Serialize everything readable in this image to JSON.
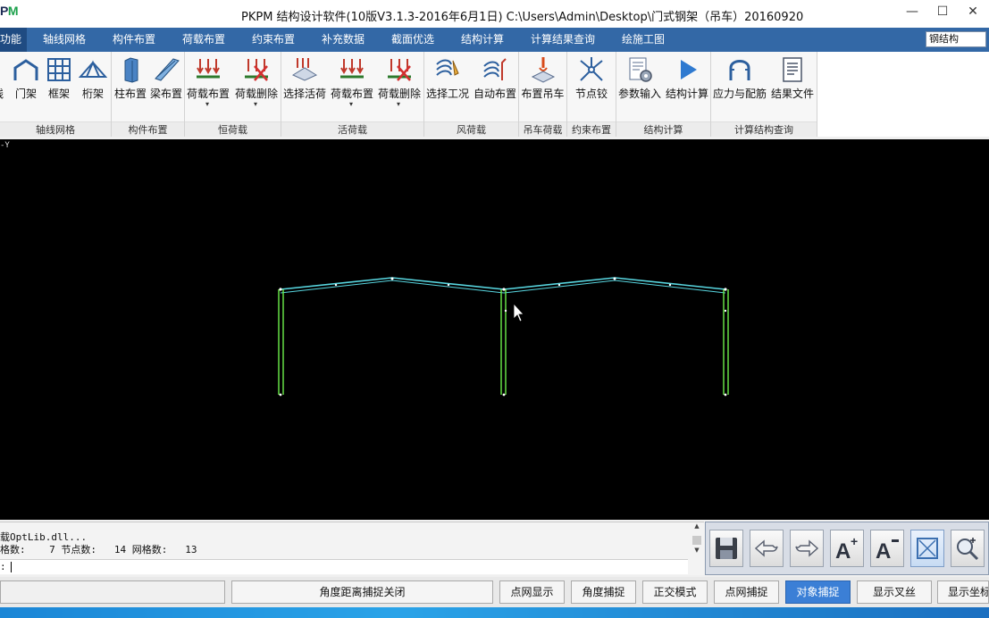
{
  "app": {
    "logo": "PM",
    "title": "PKPM 结构设计软件(10版V3.1.3-2016年6月1日) C:\\Users\\Admin\\Desktop\\门式钢架（吊车）20160920",
    "minimize": "—",
    "maximize": "☐",
    "close": "✕"
  },
  "menu": {
    "items": [
      "功能",
      "轴线网格",
      "构件布置",
      "荷载布置",
      "约束布置",
      "补充数据",
      "截面优选",
      "结构计算",
      "计算结果查询",
      "绘施工图"
    ],
    "active_index": 0,
    "right_select": "钢结构"
  },
  "ribbon": {
    "groups": [
      {
        "label": "轴线网格",
        "buttons": [
          "线",
          "门架",
          "框架",
          "桁架"
        ]
      },
      {
        "label": "构件布置",
        "buttons": [
          "柱布置",
          "梁布置"
        ]
      },
      {
        "label": "恒荷载",
        "buttons": [
          "荷载布置",
          "荷载删除"
        ]
      },
      {
        "label": "活荷载",
        "buttons": [
          "选择活荷",
          "荷载布置",
          "荷载删除"
        ]
      },
      {
        "label": "风荷载",
        "buttons": [
          "选择工况",
          "自动布置"
        ]
      },
      {
        "label": "吊车荷载",
        "buttons": [
          "布置吊车"
        ]
      },
      {
        "label": "约束布置",
        "buttons": [
          "节点铰"
        ]
      },
      {
        "label": "结构计算",
        "buttons": [
          "参数输入",
          "结构计算"
        ]
      },
      {
        "label": "计算结构查询",
        "buttons": [
          "应力与配筋",
          "结果文件"
        ]
      }
    ]
  },
  "canvas": {
    "axis_label": "-Y"
  },
  "command": {
    "line1": "载OptLib.dll...",
    "line2": "格数:    7 节点数:   14 网格数:   13",
    "prompt": ":"
  },
  "status": {
    "field_empty": "",
    "angle_snap": "角度距离捕捉关闭",
    "buttons": [
      "点网显示",
      "角度捕捉",
      "正交模式",
      "点网捕捉",
      "对象捕捉",
      "显示叉丝",
      "显示坐标"
    ],
    "active_button": "对象捕捉"
  },
  "colors": {
    "menu_bg": "#3368a6",
    "canvas_bg": "#000000",
    "column": "#6cf04a",
    "rafter": "#58d6e0",
    "active_status": "#3b7fd6"
  }
}
